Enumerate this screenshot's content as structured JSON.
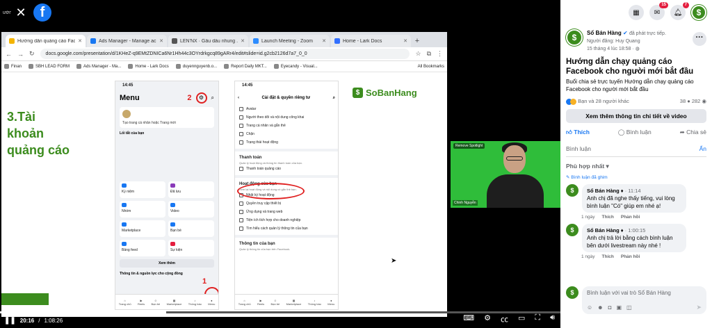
{
  "video": {
    "channel_short": "ường..",
    "time_current": "20:16",
    "time_total": "1:08:26",
    "progress": 0.296
  },
  "browser": {
    "tabs": [
      {
        "label": "Hướng dẫn quảng cáo Fac",
        "color": "#f4b400",
        "active": true
      },
      {
        "label": "Ads Manager - Manage ac",
        "color": "#1877f2",
        "active": false
      },
      {
        "label": "LEN'NX · Gẩu dấu nhung ...",
        "color": "#555555",
        "active": false
      },
      {
        "label": "Launch Meeting - Zoom",
        "color": "#2d8cff",
        "active": false
      },
      {
        "label": "Home - Lark Docs",
        "color": "#3370ff",
        "active": false
      }
    ],
    "url": "docs.google.com/presentation/d/1KHeZ-q9EMtZDNICa6Nr1Hh44c3OYrdrkgcq89gARr4/edit#slide=id.g2cb2126d7a7_0_0",
    "bookmarks": [
      "Finan",
      "SBH LEAD FORM",
      "Ads Manager - Ma...",
      "Home - Lark Docs",
      "duyennguyenb.o...",
      "Report Daily MKT...",
      "Eyecandy - Visual..."
    ],
    "all_bookmarks": "All Bookmarks"
  },
  "slide": {
    "title": "3.Tài khoản quảng cáo",
    "logo_text": "SoBanHang",
    "phone1": {
      "time": "14:45",
      "title": "Menu",
      "marker2": "2",
      "marker1": "1",
      "create_text": "Tạo trang cá nhân hoặc Trang mới",
      "shortcut": "Lối tắt của bạn",
      "tiles": [
        "Kỷ niệm",
        "Đã lưu",
        "Nhóm",
        "Video",
        "Marketplace",
        "Bạn bè",
        "Bảng feed",
        "Sự kiện"
      ],
      "see_more": "Xem thêm",
      "info": "Thông tin & nguồn lực cho cộng đồng",
      "nav": [
        "Trang chủ",
        "Reels",
        "Bạn bè",
        "Marketplace",
        "Thông báo",
        "Menu"
      ]
    },
    "phone2": {
      "time": "14:45",
      "title": "Cài đặt & quyền riêng tư",
      "items_top": [
        "Avatar",
        "Người theo dõi và nội dung công khai",
        "Trang cá nhân và gắn thẻ",
        "Chặn",
        "Trạng thái hoạt động"
      ],
      "pay_head": "Thanh toán",
      "pay_sub": "Quản lý hoạt động và thông tin thanh toán của bạn.",
      "pay_item": "Thanh toán quảng cáo",
      "act_head": "Hoạt động của bạn",
      "act_sub": "Xem lại hoạt động và nội dung có gắn thẻ bạn.",
      "act_items": [
        "Nhật ký hoạt động",
        "Quyền truy cập thiết bị",
        "Ứng dụng và trang web",
        "Tiện ích tích hợp cho doanh nghiệp",
        "Tìm hiểu cách quản lý thông tin của bạn"
      ],
      "info_head": "Thông tin của bạn",
      "info_sub": "Quản lý thông tin của bạn trên Facebook.",
      "nav": [
        "Trang chủ",
        "Reels",
        "Bạn bè",
        "Marketplace",
        "Thông báo",
        "Menu"
      ]
    }
  },
  "cam": {
    "label": "Remove Spotlight",
    "name": "Chinh Nguyễn"
  },
  "sidebar": {
    "messenger_badge": "15",
    "notif_badge": "7",
    "page_name": "Sổ Bán Hàng",
    "action_text": "đã phát trực tiếp.",
    "streamer_line": "Người đăng: Huy Quang",
    "date_line": "15 tháng 4 lúc 18:58 ·",
    "title": "Hướng dẫn chạy quảng cáo Facebook cho người mới bắt đầu",
    "desc": "Buổi chia sẻ trực tuyến Hướng dẫn chạy quảng cáo Facebook cho người mới bắt đầu",
    "reactions_text": "Bạn và 28 người khác",
    "comment_count": "38",
    "view_count": "282",
    "more_button": "Xem thêm thông tin chi tiết về video",
    "like": "Thích",
    "comment": "Bình luận",
    "share": "Chia sẻ",
    "comment_label": "Bình luận",
    "hide": "Ẩn",
    "sort": "Phù hợp nhất",
    "pinned": "Bình luận đã ghim",
    "comments": [
      {
        "name": "Sổ Bán Hàng",
        "time": "11:14",
        "text": "Anh chị đã nghe thấy tiếng, vui lòng bình luận \"Có\" giúp em nhé ạ!",
        "ago": "1 ngày",
        "like": "Thích",
        "reply": "Phản hồi"
      },
      {
        "name": "Sổ Bán Hàng",
        "time": "1:00:15",
        "text": "Anh chị trả lời bằng cách bình luận bên dưới livestream này nhé !",
        "ago": "1 ngày",
        "like": "Thích",
        "reply": "Phản hồi"
      }
    ],
    "input_placeholder": "Bình luận với vai trò Sổ Bán Hàng"
  }
}
